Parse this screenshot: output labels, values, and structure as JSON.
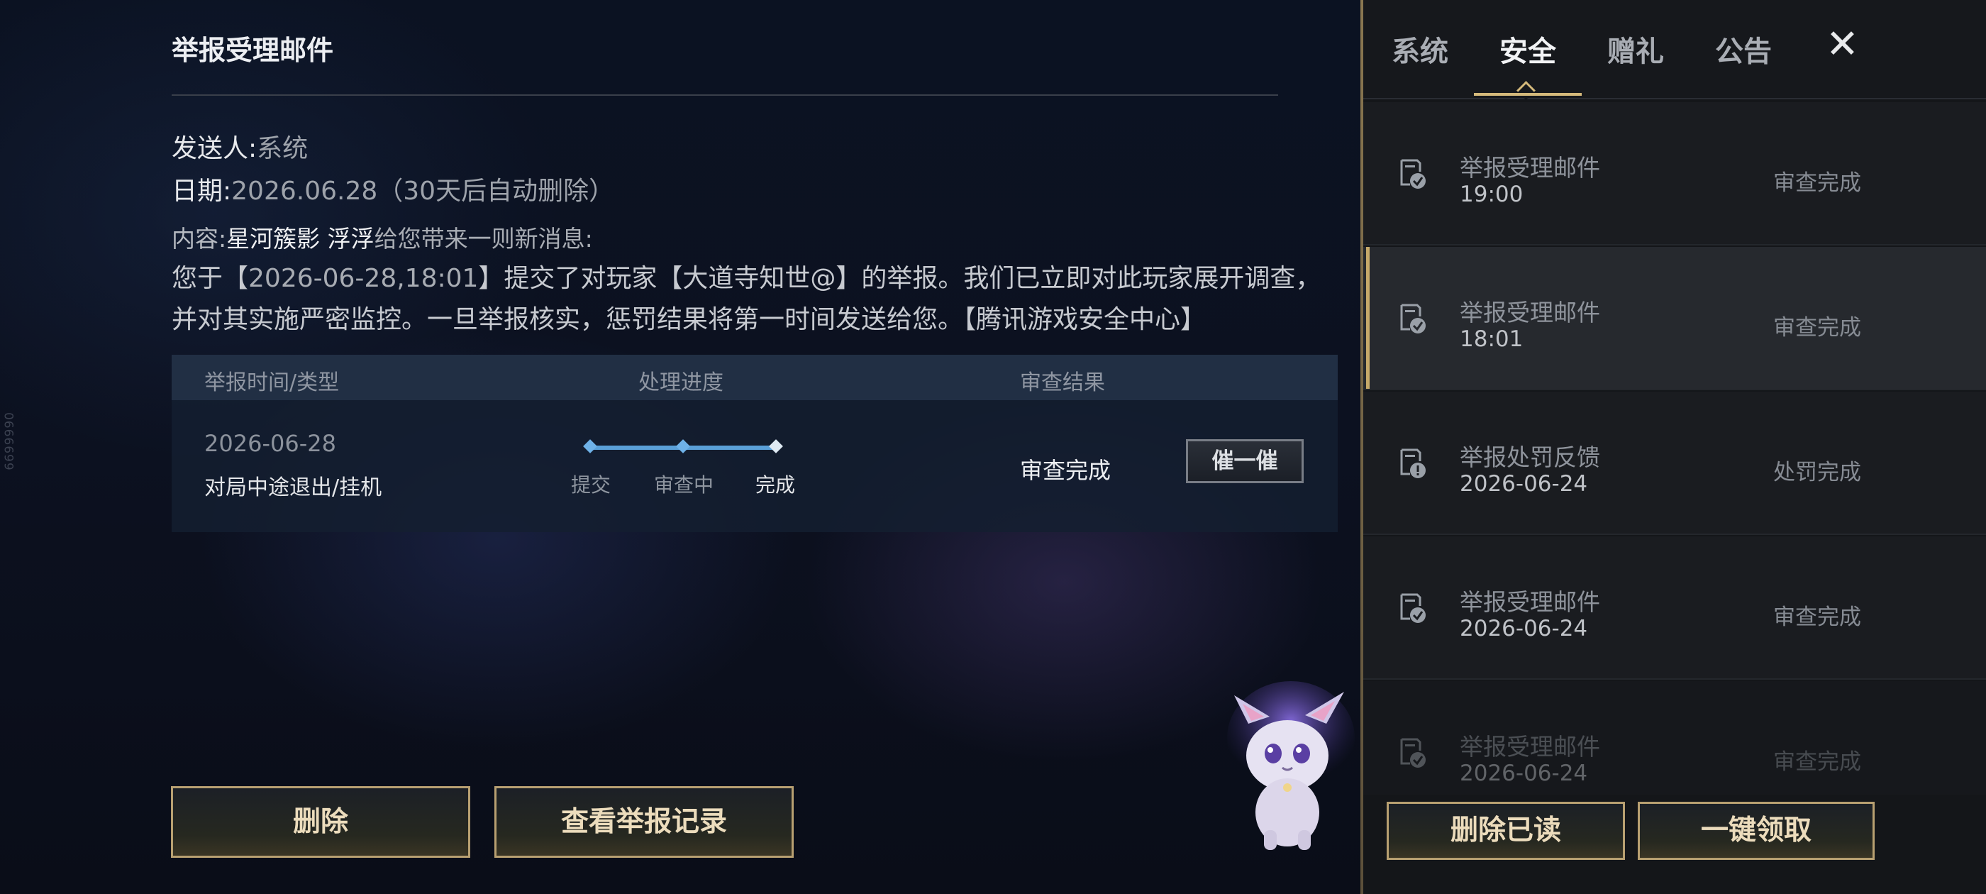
{
  "detail": {
    "title": "举报受理邮件",
    "sender_label": "发送人:",
    "sender_value": "系统",
    "date_label": "日期:",
    "date_value": "2026.06.28（30天后自动删除）",
    "content_label": "内容:",
    "content_sender": "星河簇影 浮浮",
    "content_intro": "给您带来一则新消息:",
    "body_part1": "您于【",
    "body_time": "2026-06-28,18:01",
    "body_part2": "】提交了对玩家【大道寺知世@】的举报。我们已立即对此玩家展开调查，并对其实施严密监控。一旦举报核实，惩罚结果将第一时间发送给您。【腾讯游戏安全中心】"
  },
  "report_table": {
    "headers": [
      "举报时间/类型",
      "处理进度",
      "审查结果"
    ],
    "row": {
      "date": "2026-06-28",
      "type": "对局中途退出/挂机",
      "progress_steps": [
        "提交",
        "审查中",
        "完成"
      ],
      "current_step": 3,
      "result": "审查完成",
      "urge_label": "催一催"
    }
  },
  "actions": {
    "delete_label": "删除",
    "view_records_label": "查看举报记录"
  },
  "side_id": "6699990",
  "tabs": [
    "系统",
    "安全",
    "赠礼",
    "公告"
  ],
  "active_tab": "安全",
  "close_icon": "close-icon",
  "mail_list": [
    {
      "title": "举报受理邮件",
      "time": "19:00",
      "status": "审查完成",
      "icon": "mail-check-icon",
      "selected": false
    },
    {
      "title": "举报受理邮件",
      "time": "18:01",
      "status": "审查完成",
      "icon": "mail-check-icon",
      "selected": true
    },
    {
      "title": "举报处罚反馈",
      "time": "2026-06-24",
      "status": "处罚完成",
      "icon": "mail-alert-icon",
      "selected": false
    },
    {
      "title": "举报受理邮件",
      "time": "2026-06-24",
      "status": "审查完成",
      "icon": "mail-check-icon",
      "selected": false
    },
    {
      "title": "举报受理邮件",
      "time": "2026-06-24",
      "status": "审查完成",
      "icon": "mail-check-icon",
      "selected": false
    }
  ],
  "list_actions": {
    "delete_read_label": "删除已读",
    "claim_all_label": "一键领取"
  },
  "colors": {
    "gold_accent": "#c6a96a",
    "progress_blue": "#5aa0d8",
    "panel_bg": "#141619"
  }
}
